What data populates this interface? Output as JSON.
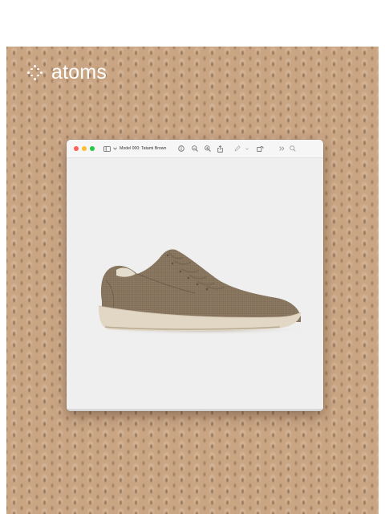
{
  "brand": {
    "name": "atoms",
    "icon": "sparkle-dots-icon"
  },
  "window": {
    "title": "Model 000: Tatami Brown",
    "traffic_lights": {
      "close_color": "#fe5f57",
      "minimize_color": "#febc2e",
      "zoom_color": "#28c840"
    },
    "toolbar": {
      "sidebar_icon": "sidebar-icon",
      "chevron_icon": "chevron-down-icon",
      "info_icon": "info-icon",
      "zoom_out_icon": "zoom-out-icon",
      "zoom_in_icon": "zoom-in-icon",
      "share_icon": "share-icon",
      "markup_icon": "markup-pen-icon",
      "rotate_icon": "rotate-icon",
      "more_icon": "more-chevrons-icon",
      "search_icon": "search-icon"
    },
    "image": {
      "subject": "shoe-image",
      "upper_color": "#8d7a63",
      "sole_color": "#e2d7c5"
    }
  },
  "background": {
    "texture_color": "#c9a584"
  }
}
